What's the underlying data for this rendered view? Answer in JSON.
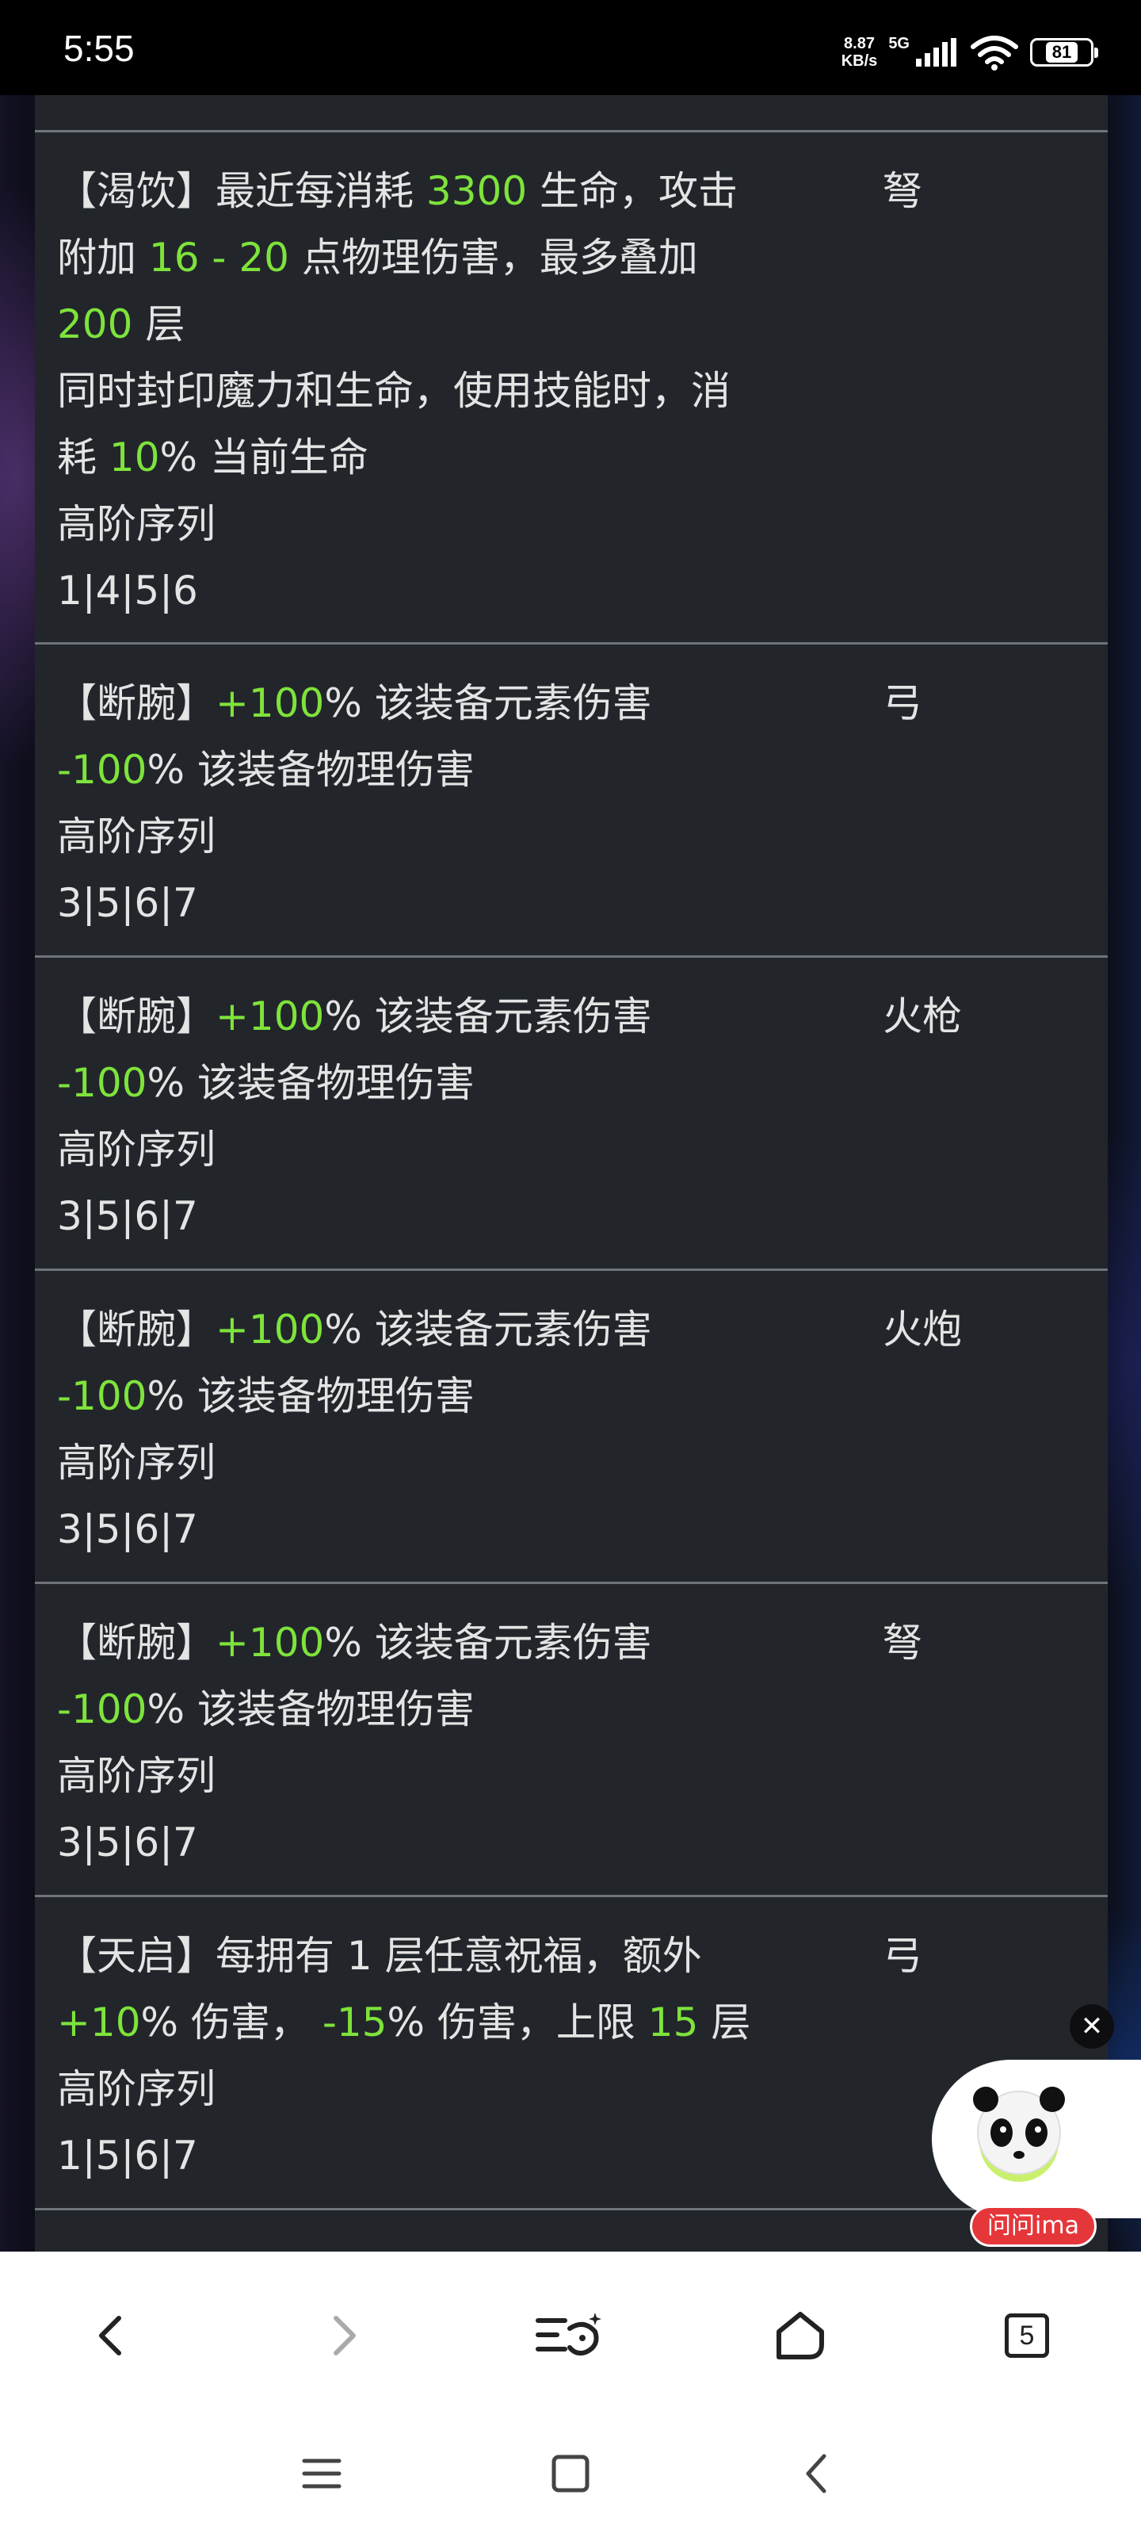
{
  "status_bar": {
    "time": "5:55",
    "net_speed_value": "8.87",
    "net_speed_unit": "KB/s",
    "network_type": "5G",
    "battery": "81"
  },
  "rows": [
    {
      "lines": [
        [
          {
            "t": "【渴饮】最近每消耗 "
          },
          {
            "t": "3300",
            "g": true
          },
          {
            "t": " 生命，攻击"
          }
        ],
        [
          {
            "t": "附加 "
          },
          {
            "t": "16 - 20",
            "g": true
          },
          {
            "t": " 点物理伤害，最多叠加"
          }
        ],
        [
          {
            "t": "200",
            "g": true
          },
          {
            "t": " 层"
          }
        ],
        [
          {
            "t": "同时封印魔力和生命，使用技能时，消"
          }
        ],
        [
          {
            "t": "耗 "
          },
          {
            "t": "10",
            "g": true
          },
          {
            "t": "% 当前生命"
          }
        ],
        [
          {
            "t": "高阶序列"
          }
        ],
        [
          {
            "t": "1|4|5|6"
          }
        ]
      ],
      "weapon": "弩"
    },
    {
      "lines": [
        [
          {
            "t": "【断腕】"
          },
          {
            "t": "+100",
            "g": true
          },
          {
            "t": "% 该装备元素伤害"
          }
        ],
        [
          {
            "t": "-100",
            "g": true
          },
          {
            "t": "% 该装备物理伤害"
          }
        ],
        [
          {
            "t": "高阶序列"
          }
        ],
        [
          {
            "t": "3|5|6|7"
          }
        ]
      ],
      "weapon": "弓"
    },
    {
      "lines": [
        [
          {
            "t": "【断腕】"
          },
          {
            "t": "+100",
            "g": true
          },
          {
            "t": "% 该装备元素伤害"
          }
        ],
        [
          {
            "t": "-100",
            "g": true
          },
          {
            "t": "% 该装备物理伤害"
          }
        ],
        [
          {
            "t": "高阶序列"
          }
        ],
        [
          {
            "t": "3|5|6|7"
          }
        ]
      ],
      "weapon": "火枪"
    },
    {
      "lines": [
        [
          {
            "t": "【断腕】"
          },
          {
            "t": "+100",
            "g": true
          },
          {
            "t": "% 该装备元素伤害"
          }
        ],
        [
          {
            "t": "-100",
            "g": true
          },
          {
            "t": "% 该装备物理伤害"
          }
        ],
        [
          {
            "t": "高阶序列"
          }
        ],
        [
          {
            "t": "3|5|6|7"
          }
        ]
      ],
      "weapon": "火炮"
    },
    {
      "lines": [
        [
          {
            "t": "【断腕】"
          },
          {
            "t": "+100",
            "g": true
          },
          {
            "t": "% 该装备元素伤害"
          }
        ],
        [
          {
            "t": "-100",
            "g": true
          },
          {
            "t": "% 该装备物理伤害"
          }
        ],
        [
          {
            "t": "高阶序列"
          }
        ],
        [
          {
            "t": "3|5|6|7"
          }
        ]
      ],
      "weapon": "弩"
    },
    {
      "lines": [
        [
          {
            "t": "【天启】每拥有 1 层任意祝福，额外"
          }
        ],
        [
          {
            "t": "+10",
            "g": true
          },
          {
            "t": "% 伤害， "
          },
          {
            "t": "-15",
            "g": true
          },
          {
            "t": "% 伤害，上限 "
          },
          {
            "t": "15",
            "g": true
          },
          {
            "t": " 层"
          }
        ],
        [
          {
            "t": "高阶序列"
          }
        ],
        [
          {
            "t": "1|5|6|7"
          }
        ]
      ],
      "weapon": "弓"
    }
  ],
  "assistant": {
    "close_glyph": "✕",
    "badge_label": "问问ima"
  },
  "toolbar": {
    "tab_count": "5",
    "icons": [
      "back-icon",
      "forward-icon",
      "ai-reading-icon",
      "home-icon",
      "tabs-icon"
    ]
  },
  "system_nav": {
    "icons": [
      "recent-apps-icon",
      "home-square-icon",
      "system-back-icon"
    ]
  },
  "colors": {
    "highlight": "#7ee33b",
    "table_bg": "#22262b",
    "divider": "#6e747b",
    "badge": "#e5363a"
  }
}
